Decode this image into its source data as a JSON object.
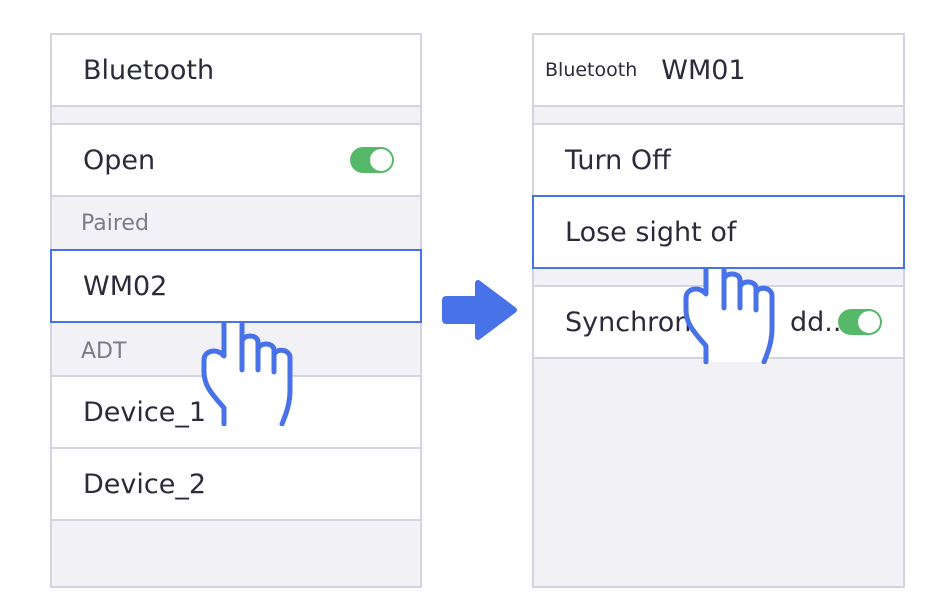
{
  "left_screen": {
    "header": "Bluetooth",
    "open_label": "Open",
    "open_toggle_on": true,
    "paired_section": "Paired",
    "paired_device": "WM02",
    "adt_section": "ADT",
    "devices": [
      "Device_1",
      "Device_2"
    ]
  },
  "right_screen": {
    "header_small": "Bluetooth",
    "header_device": "WM01",
    "menu": {
      "turn_off": "Turn Off",
      "lose_sight": "Lose sight of"
    },
    "sync_label": "Synchron",
    "sync_label_tail": "dd...",
    "sync_toggle_on": true
  },
  "colors": {
    "accent": "#4872e8",
    "toggle_on": "#56b96a",
    "border": "#d3d4de",
    "background": "#f1f1f6"
  },
  "icons": [
    "pointing-hand-icon",
    "arrow-right-icon"
  ]
}
